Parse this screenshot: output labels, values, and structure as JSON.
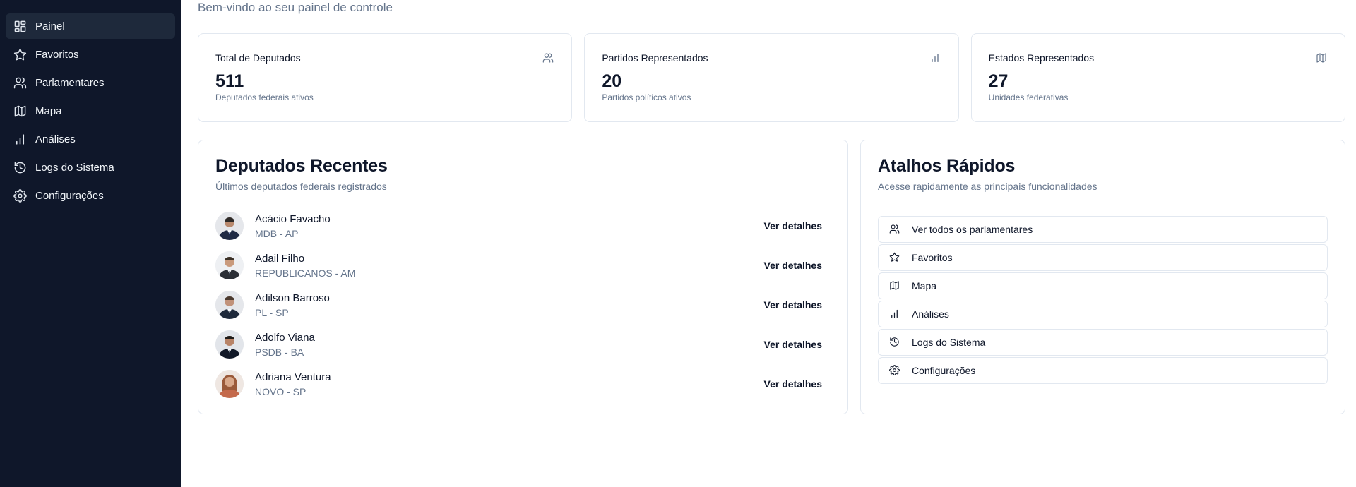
{
  "sidebar": {
    "items": [
      {
        "label": "Painel",
        "icon": "dashboard-icon",
        "active": true
      },
      {
        "label": "Favoritos",
        "icon": "star-icon"
      },
      {
        "label": "Parlamentares",
        "icon": "users-icon"
      },
      {
        "label": "Mapa",
        "icon": "map-icon"
      },
      {
        "label": "Análises",
        "icon": "bar-chart-icon"
      },
      {
        "label": "Logs do Sistema",
        "icon": "history-icon"
      },
      {
        "label": "Configurações",
        "icon": "gear-icon"
      }
    ]
  },
  "header": {
    "subtitle": "Bem-vindo ao seu painel de controle"
  },
  "stats": [
    {
      "title": "Total de Deputados",
      "value": "511",
      "desc": "Deputados federais ativos",
      "icon": "users-icon"
    },
    {
      "title": "Partidos Representados",
      "value": "20",
      "desc": "Partidos políticos ativos",
      "icon": "bar-chart-icon"
    },
    {
      "title": "Estados Representados",
      "value": "27",
      "desc": "Unidades federativas",
      "icon": "map-icon"
    }
  ],
  "recent": {
    "title": "Deputados Recentes",
    "desc": "Últimos deputados federais registrados",
    "link_label": "Ver detalhes",
    "rows": [
      {
        "name": "Acácio Favacho",
        "party": "MDB - AP"
      },
      {
        "name": "Adail Filho",
        "party": "REPUBLICANOS - AM"
      },
      {
        "name": "Adilson Barroso",
        "party": "PL - SP"
      },
      {
        "name": "Adolfo Viana",
        "party": "PSDB - BA"
      },
      {
        "name": "Adriana Ventura",
        "party": "NOVO - SP"
      }
    ]
  },
  "shortcuts": {
    "title": "Atalhos Rápidos",
    "desc": "Acesse rapidamente as principais funcionalidades",
    "items": [
      {
        "label": "Ver todos os parlamentares",
        "icon": "users-icon"
      },
      {
        "label": "Favoritos",
        "icon": "star-icon"
      },
      {
        "label": "Mapa",
        "icon": "map-icon"
      },
      {
        "label": "Análises",
        "icon": "bar-chart-icon"
      },
      {
        "label": "Logs do Sistema",
        "icon": "history-icon"
      },
      {
        "label": "Configurações",
        "icon": "gear-icon"
      }
    ]
  },
  "colors": {
    "sidebar_bg": "#0f172a",
    "sidebar_active": "#1e293b",
    "muted_text": "#64748b",
    "border": "#e2e8f0"
  }
}
